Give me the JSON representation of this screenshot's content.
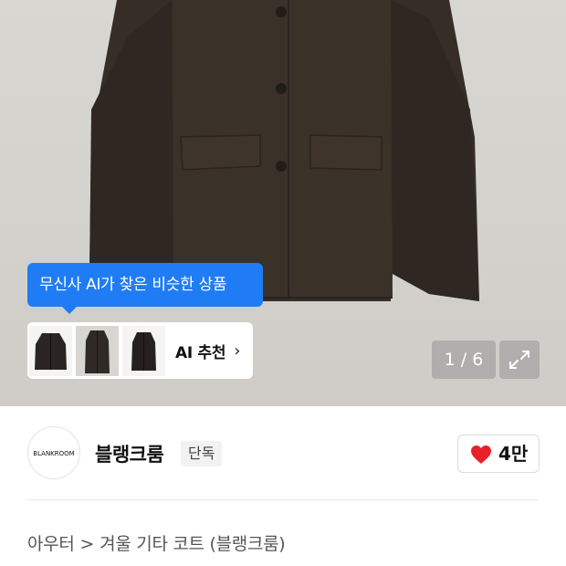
{
  "image_viewer": {
    "ai_tooltip": "무신사 AI가 찾은 비슷한 상품",
    "ai_recommend_label": "AI 추천",
    "counter": "1 / 6",
    "icons": {
      "arrow": "chevron-right-icon",
      "expand": "expand-icon"
    }
  },
  "brand": {
    "logo_text": "BLANKROOM",
    "name": "블랭크룸",
    "badge": "단독",
    "like_count": "4만"
  },
  "breadcrumb": {
    "category": "아우터",
    "separator": ">",
    "product": "겨울 기타 코트 (블랭크룸)"
  },
  "colors": {
    "accent_blue": "#1f7cf5",
    "heart_red": "#e8202a",
    "coat": "#352d26"
  }
}
